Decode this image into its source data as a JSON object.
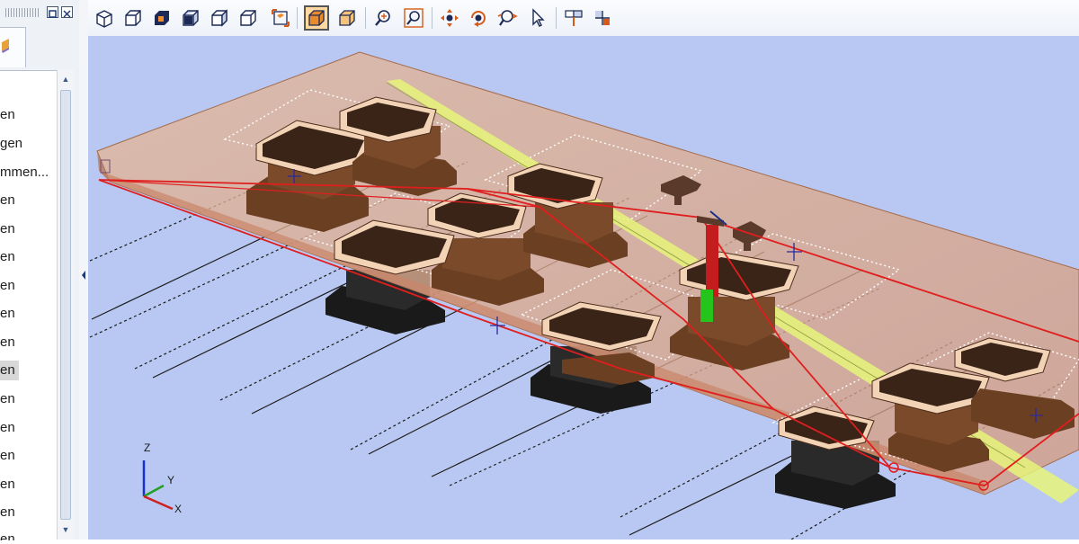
{
  "panel": {
    "tree_items": [
      "en",
      "gen",
      "mmen...",
      "en",
      "en",
      "en",
      "en",
      "en",
      "en",
      "en",
      "en",
      "en",
      "en",
      "en",
      "en",
      "en"
    ],
    "selected_index": 9
  },
  "toolbar": {
    "buttons": [
      "view-iso-icon",
      "view-front-icon",
      "view-shaded-icon",
      "view-back-icon",
      "view-left-icon",
      "view-right-icon",
      "view-fit-icon",
      "view-solid-icon",
      "view-transparent-icon",
      "zoom-icon",
      "zoom-window-icon",
      "pan-icon",
      "rotate-icon",
      "zoom-dynamic-icon",
      "select-pointer-icon",
      "section-icon",
      "split-icon"
    ],
    "active": "view-solid-icon"
  },
  "axis": {
    "x": "X",
    "y": "Y",
    "z": "Z"
  },
  "colors": {
    "viewport_bg": "#b8c8f2",
    "plate": "#d9a88a",
    "path": "#e01e1e",
    "fixture": "#7a4a2a"
  }
}
